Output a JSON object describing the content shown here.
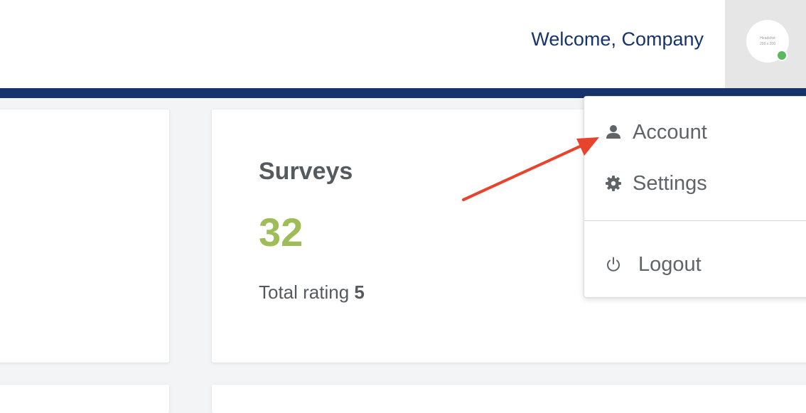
{
  "header": {
    "welcome_text": "Welcome, Company",
    "avatar_placeholder_line1": "Headshot",
    "avatar_placeholder_line2": "200 x 200"
  },
  "surveys_card": {
    "title": "Surveys",
    "count": "32",
    "rating_label": "Total rating",
    "rating_value": "5"
  },
  "user_menu": {
    "items": [
      {
        "label": "Account",
        "icon": "person-icon"
      },
      {
        "label": "Settings",
        "icon": "gear-icon"
      },
      {
        "label": "Logout",
        "icon": "power-icon"
      }
    ]
  },
  "colors": {
    "brand_blue": "#16346b",
    "value_green": "#9ebc57",
    "online_green": "#5cb85c",
    "annotation_arrow": "#e8432c"
  }
}
